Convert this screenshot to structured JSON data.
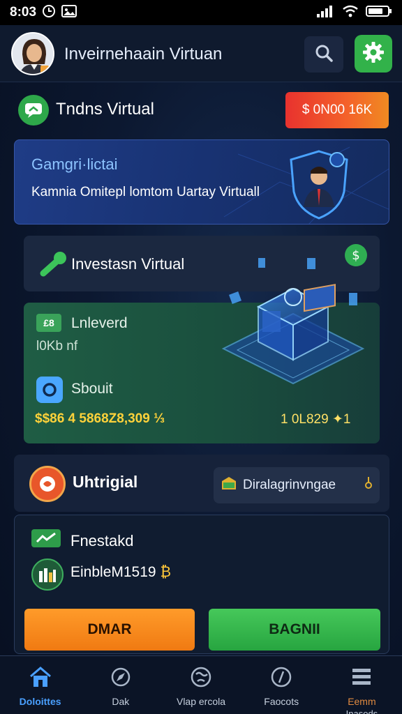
{
  "status_bar": {
    "time": "8:03"
  },
  "header": {
    "title": "Inveirnehaain Virtuan"
  },
  "section": {
    "title": "Tndns Virtual",
    "balance_badge": "$ 0N00 16K"
  },
  "promo": {
    "title": "Gamgri·lictai",
    "text": "Kamnia Omitepl lomtom Uartay Virtuall"
  },
  "invest": {
    "label": "Investasn Virtual"
  },
  "green_panel": {
    "icon_text": "£8",
    "label1": "Lnleverd",
    "sub": "l0Kb nf",
    "label2": "Sbouit",
    "amount": "$$86 4 5868Z8,309 ⅓",
    "right_value": "1  0L829 ✦1"
  },
  "lower": {
    "label": "Uhtrigial",
    "dropdown": "Diralagrinvngae"
  },
  "bottom_card": {
    "label1": "Fnestakd",
    "label2": "EinbleM1519",
    "coin": "₿",
    "btn_left": "DMAR",
    "btn_right": "BAGNII"
  },
  "nav": {
    "items": [
      {
        "label": "Doloittes"
      },
      {
        "label": "Dak"
      },
      {
        "label": "Vlap ercola"
      },
      {
        "label": "Faocots"
      },
      {
        "label": "Eemm",
        "sub": "Inasods"
      }
    ]
  },
  "colors": {
    "accent_green": "#32b24a",
    "accent_orange": "#f07a12",
    "accent_blue": "#4aa0ff"
  }
}
